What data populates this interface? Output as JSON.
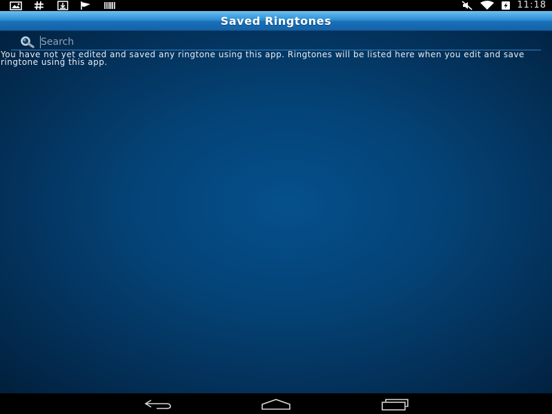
{
  "status_bar": {
    "time": "11:18",
    "left_icons": [
      "gallery-notification-icon",
      "hash-notification-icon",
      "download-notification-icon",
      "flag-notification-icon",
      "barcode-notification-icon"
    ],
    "right_icons": [
      "mute-icon",
      "wifi-icon",
      "battery-charging-icon"
    ]
  },
  "header": {
    "title": "Saved Ringtones"
  },
  "search": {
    "placeholder": "Search",
    "value": ""
  },
  "main": {
    "empty_message": "You have not yet edited and saved any ringtone using this app. Ringtones will be listed here when you edit and save ringtone using this app."
  },
  "nav_bar": {
    "buttons": [
      "back-icon",
      "home-icon",
      "recent-apps-icon"
    ]
  },
  "colors": {
    "title_bar_top": "#6ec0f2",
    "title_bar_bottom": "#1463a8",
    "background_center": "#05508d",
    "background_edge": "#021f3c",
    "search_underline": "#2f86c6"
  }
}
